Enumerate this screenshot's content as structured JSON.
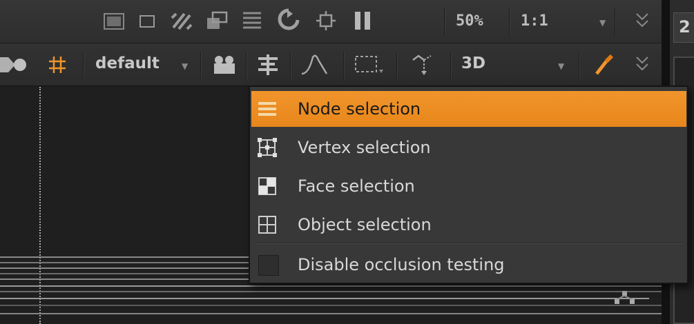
{
  "toolbar_top": {
    "zoom": "50%",
    "ratio": "1:1",
    "icons": [
      "overlay-icon",
      "square-icon",
      "hatch-icon",
      "window-icon",
      "lines-icon",
      "refresh-icon",
      "crop-icon",
      "pause-icon",
      "more-icon"
    ]
  },
  "toolbar_bottom": {
    "lut": "default",
    "view_mode": "3D",
    "icons": [
      "grid-icon",
      "viewer-input-icon",
      "align-icon",
      "curve-icon",
      "selection-icon",
      "transform-icon",
      "color-picker-icon",
      "more-icon"
    ]
  },
  "side_panel": {
    "number": "2"
  },
  "selection_menu": {
    "items": [
      {
        "label": "Node selection",
        "icon": "node-selection-icon",
        "active": true
      },
      {
        "label": "Vertex selection",
        "icon": "vertex-selection-icon",
        "active": false
      },
      {
        "label": "Face selection",
        "icon": "face-selection-icon",
        "active": false
      },
      {
        "label": "Object selection",
        "icon": "object-selection-icon",
        "active": false
      }
    ],
    "checkbox": {
      "label": "Disable occlusion testing",
      "checked": false
    }
  },
  "colors": {
    "accent": "#f0952c",
    "background": "#1c1c1c",
    "toolbar": "#323232",
    "menu": "#383838"
  }
}
